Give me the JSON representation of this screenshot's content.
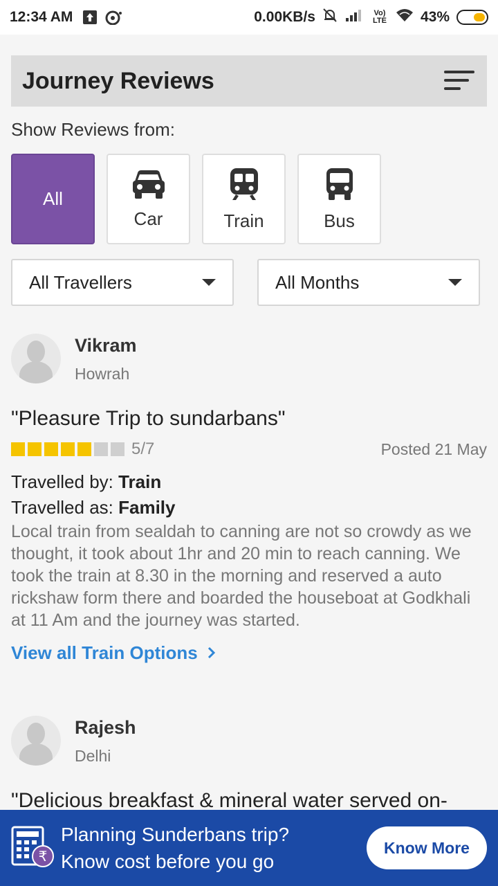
{
  "status_bar": {
    "time": "12:34 AM",
    "speed": "0.00KB/s",
    "network": "Vo) LTE",
    "battery": "43%",
    "icons": [
      "upload-icon",
      "cast-icon",
      "mute-icon",
      "signal-icon",
      "wifi-icon",
      "battery-icon"
    ]
  },
  "header": {
    "title": "Journey Reviews",
    "sort_icon": "sort-icon"
  },
  "filter_label": "Show Reviews from:",
  "modes": [
    {
      "label": "All",
      "active": true
    },
    {
      "label": "Car",
      "icon": "car-icon",
      "active": false
    },
    {
      "label": "Train",
      "icon": "train-icon",
      "active": false
    },
    {
      "label": "Bus",
      "icon": "bus-icon",
      "active": false
    }
  ],
  "filters": {
    "travellers": "All Travellers",
    "months": "All Months"
  },
  "reviews": [
    {
      "name": "Vikram",
      "location": "Howrah",
      "title": "\"Pleasure Trip to sundarbans\"",
      "rating": 5,
      "rating_max": 7,
      "rating_text": "5/7",
      "posted": "Posted 21 May",
      "travelled_by_label": "Travelled by: ",
      "travelled_by": "Train",
      "travelled_as_label": "Travelled as: ",
      "travelled_as": "Family",
      "text": "Local train from sealdah to canning are not so crowdy as we thought, it took about 1hr and 20 min to reach canning. We took the train at 8.30 in the morning and reserved a auto rickshaw form there and boarded the houseboat at Godkhali at 11 Am and the journey was started.",
      "link": "View all Train Options"
    },
    {
      "name": "Rajesh",
      "location": "Delhi",
      "title": "\"Delicious breakfast & mineral water served on-"
    }
  ],
  "banner": {
    "line1": "Planning Sunderbans trip?",
    "line2": "Know cost before you go",
    "button": "Know More",
    "icon": "calculator-rupee-icon"
  },
  "colors": {
    "accent_purple": "#7b52a6",
    "link_blue": "#2f86d6",
    "banner_blue": "#1b4aa6",
    "star_yellow": "#f5c400"
  }
}
